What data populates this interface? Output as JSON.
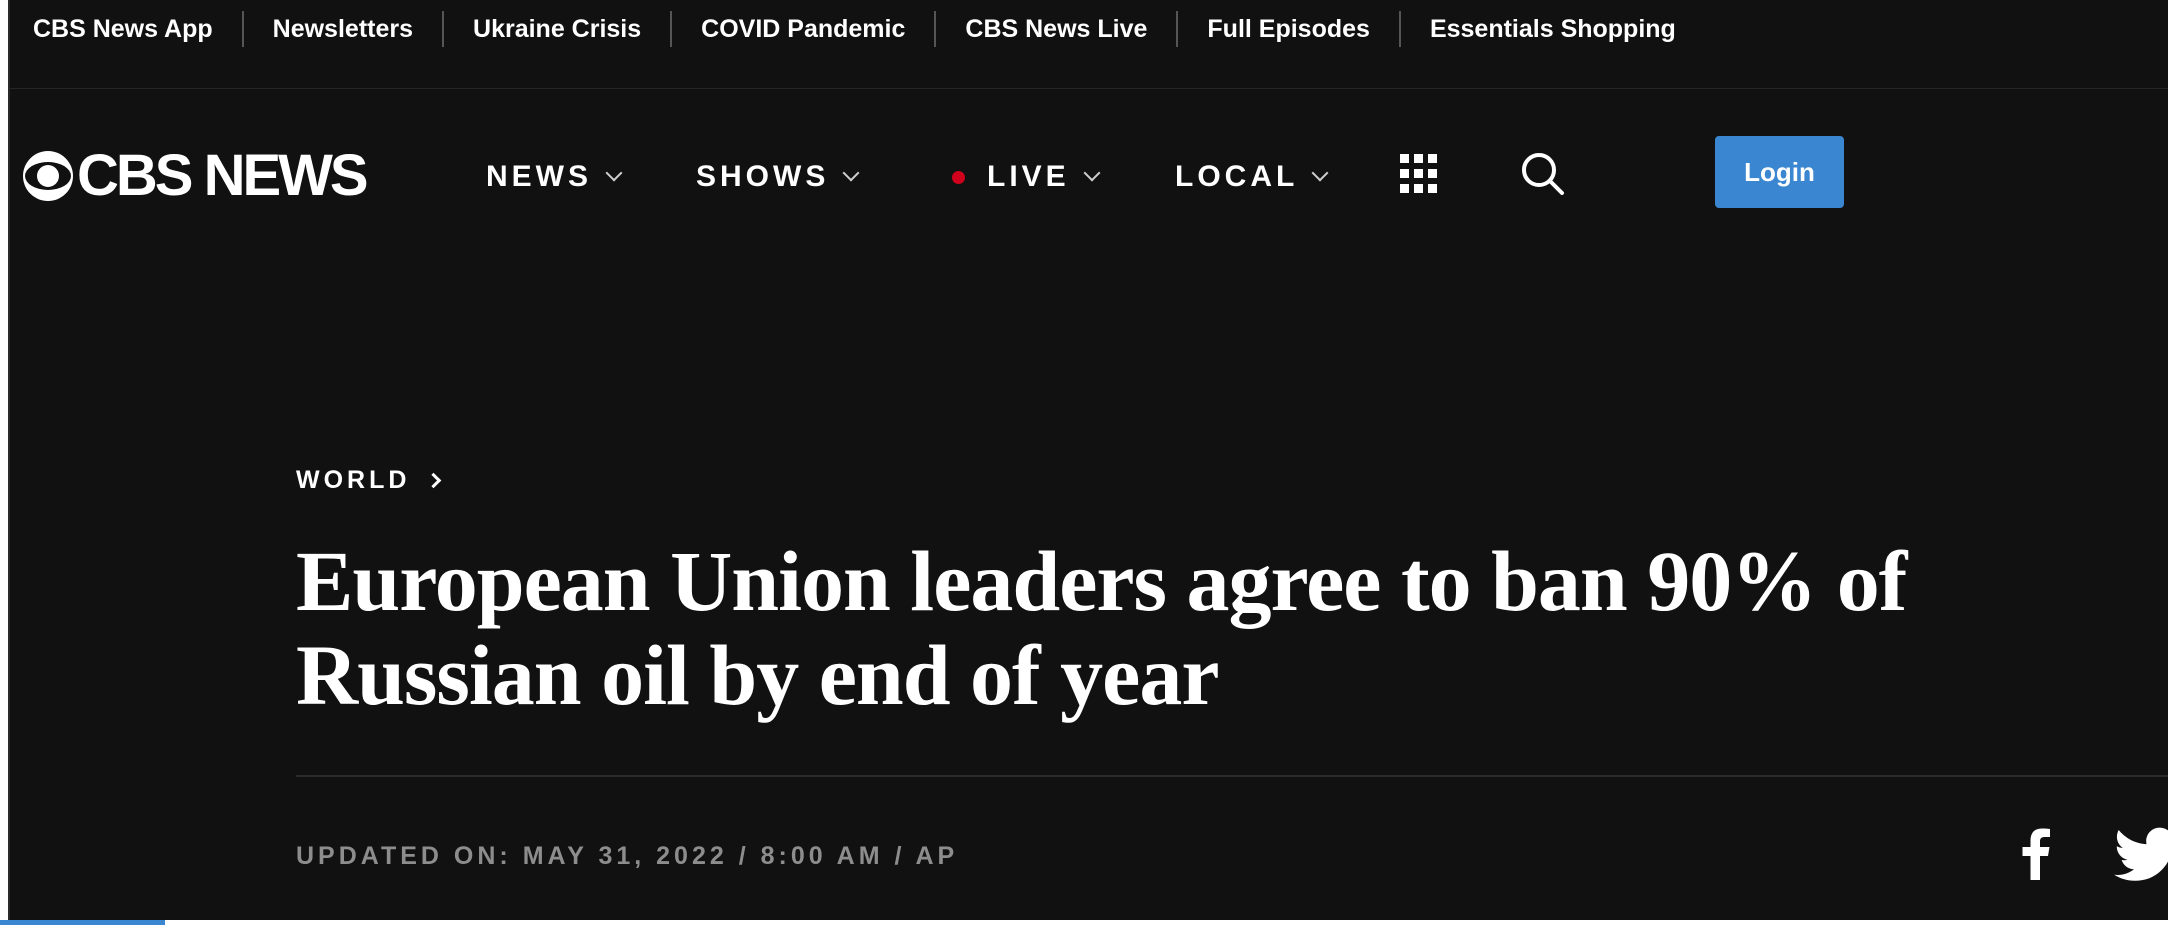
{
  "topbar": {
    "links": [
      "CBS News App",
      "Newsletters",
      "Ukraine Crisis",
      "COVID Pandemic",
      "CBS News Live",
      "Full Episodes",
      "Essentials Shopping"
    ]
  },
  "header": {
    "logo_text": "CBS NEWS",
    "nav": {
      "news": "NEWS",
      "shows": "SHOWS",
      "live": "LIVE",
      "local": "LOCAL"
    },
    "login_label": "Login",
    "icons": [
      "cbs-eye-icon",
      "chevron-down-icon",
      "live-dot-icon",
      "grid-menu-icon",
      "search-icon"
    ]
  },
  "article": {
    "section": "WORLD",
    "headline": "European Union leaders agree to ban 90% of Russian oil by end of year",
    "byline": "UPDATED ON: MAY 31, 2022 / 8:00 AM / AP",
    "share_icons": [
      "facebook-icon",
      "twitter-icon"
    ]
  },
  "colors": {
    "background": "#111111",
    "accent_blue": "#3a86d1",
    "live_red": "#d0021b",
    "byline_gray": "#8d8d8d"
  }
}
